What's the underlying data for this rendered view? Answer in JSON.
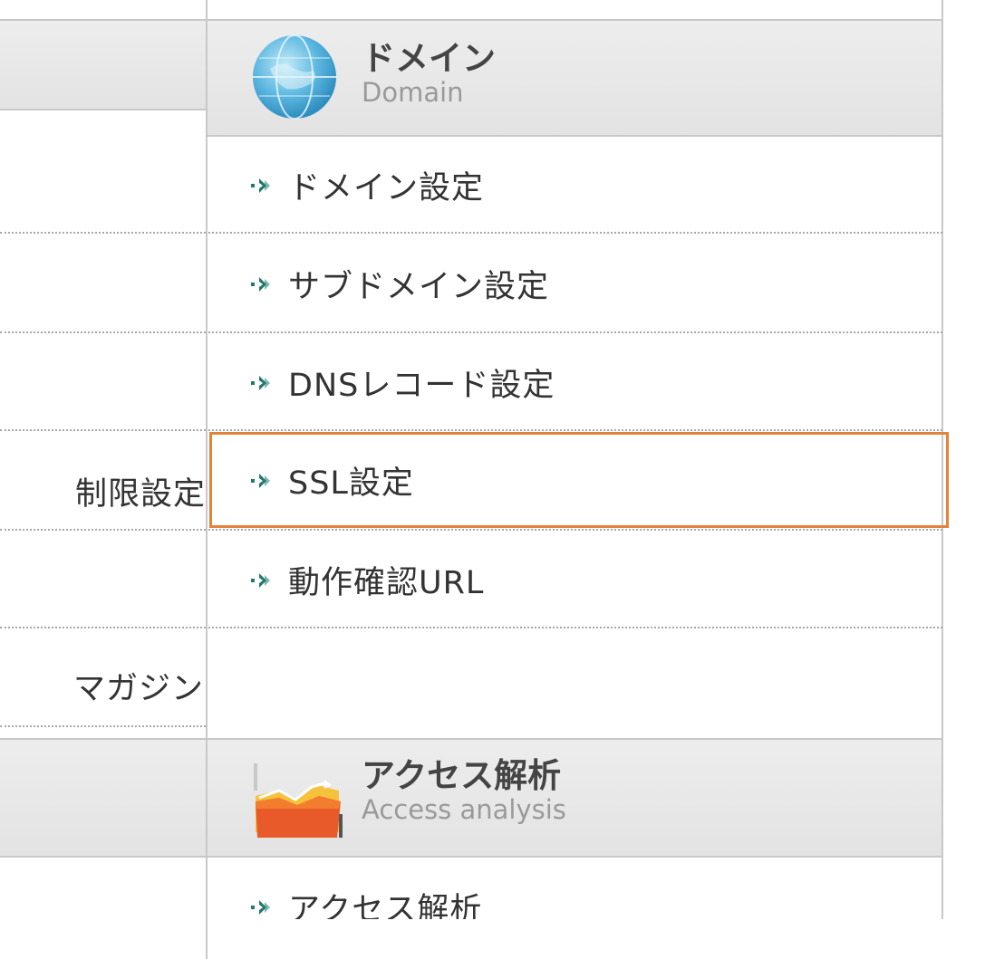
{
  "left_column": {
    "labels": [
      "制限設定",
      "マガジン"
    ]
  },
  "domain_section": {
    "title_ja": "ドメイン",
    "title_en": "Domain",
    "icon": "globe-icon",
    "items": [
      {
        "label": "ドメイン設定"
      },
      {
        "label": "サブドメイン設定"
      },
      {
        "label": "DNSレコード設定"
      },
      {
        "label": "SSL設定"
      },
      {
        "label": "動作確認URL"
      }
    ],
    "selected_index": 3
  },
  "access_section": {
    "title_ja": "アクセス解析",
    "title_en": "Access analysis",
    "icon": "chart-folder-icon",
    "items": [
      {
        "label": "アクセス解析"
      }
    ]
  },
  "colors": {
    "highlight": "#e3823a",
    "arrow": "#1f7a6c",
    "border": "#c8c8c8"
  }
}
